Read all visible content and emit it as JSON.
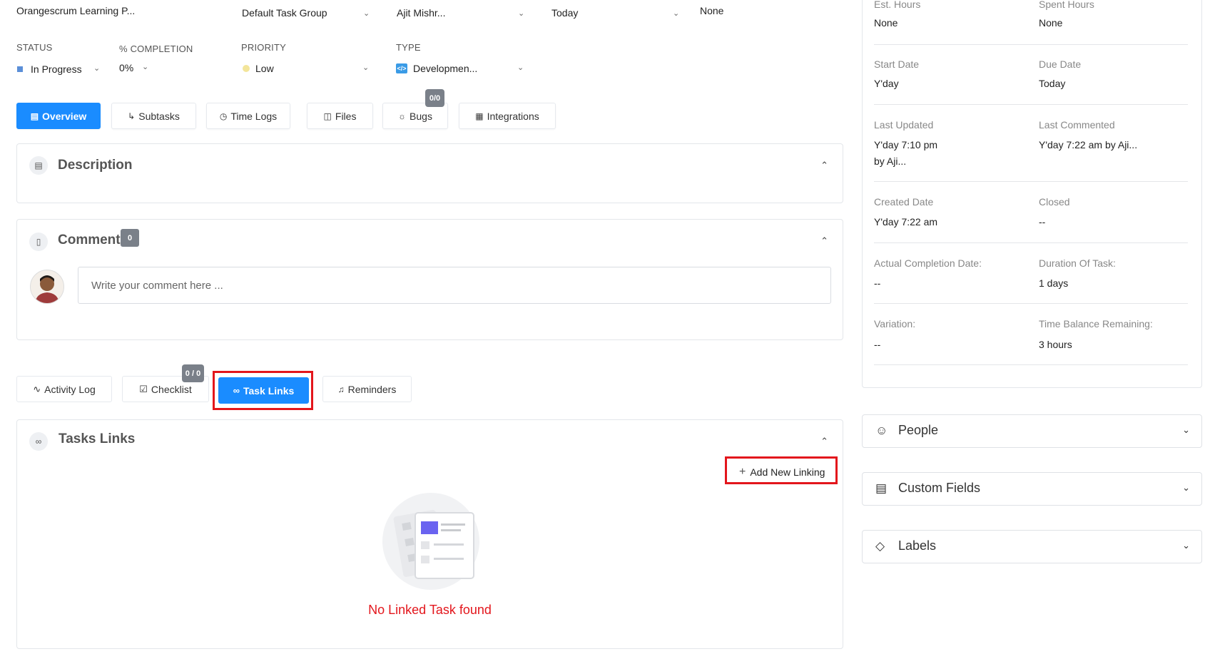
{
  "header": {
    "project": "Orangescrum Learning P...",
    "task_group": "Default Task Group",
    "assignee": "Ajit Mishr...",
    "due": "Today",
    "other": "None"
  },
  "fields": {
    "status_label": "STATUS",
    "status_value": "In Progress",
    "completion_label": "% COMPLETION",
    "completion_value": "0%",
    "priority_label": "PRIORITY",
    "priority_value": "Low",
    "type_label": "TYPE",
    "type_value": "Developmen..."
  },
  "tabs": {
    "overview": "Overview",
    "subtasks": "Subtasks",
    "time_logs": "Time Logs",
    "files": "Files",
    "bugs": "Bugs",
    "bugs_badge": "0/0",
    "integrations": "Integrations"
  },
  "description": {
    "title": "Description"
  },
  "comment": {
    "title": "Comment",
    "count": "0",
    "placeholder": "Write your comment here ..."
  },
  "bottom_tabs": {
    "activity_log": "Activity Log",
    "checklist": "Checklist",
    "checklist_badge": "0 / 0",
    "task_links": "Task Links",
    "reminders": "Reminders"
  },
  "task_links": {
    "title": "Tasks Links",
    "add_button": "Add New Linking",
    "empty_text": "No Linked Task found"
  },
  "right_panel": {
    "est_hours_label": "Est. Hours",
    "est_hours_value": "None",
    "spent_hours_label": "Spent Hours",
    "spent_hours_value": "None",
    "start_date_label": "Start Date",
    "start_date_value": "Y'day",
    "due_date_label": "Due Date",
    "due_date_value": "Today",
    "last_updated_label": "Last Updated",
    "last_updated_value": "Y'day 7:10 pm",
    "last_updated_by": "by Aji...",
    "last_commented_label": "Last Commented",
    "last_commented_value": "Y'day 7:22 am by Aji...",
    "created_date_label": "Created Date",
    "created_date_value": "Y'day 7:22 am",
    "closed_label": "Closed",
    "closed_value": "--",
    "actual_completion_label": "Actual Completion Date:",
    "actual_completion_value": "--",
    "duration_label": "Duration Of Task:",
    "duration_value": "1 days",
    "variation_label": "Variation:",
    "variation_value": "--",
    "time_balance_label": "Time Balance Remaining:",
    "time_balance_value": "3 hours"
  },
  "accordions": {
    "people": "People",
    "custom_fields": "Custom Fields",
    "labels": "Labels"
  },
  "colors": {
    "accent": "#1a8cff",
    "highlight": "#e3161c",
    "empty_text": "#e3161c",
    "status_dot": "#5b8fd8",
    "priority_dot": "#f3e59a"
  }
}
